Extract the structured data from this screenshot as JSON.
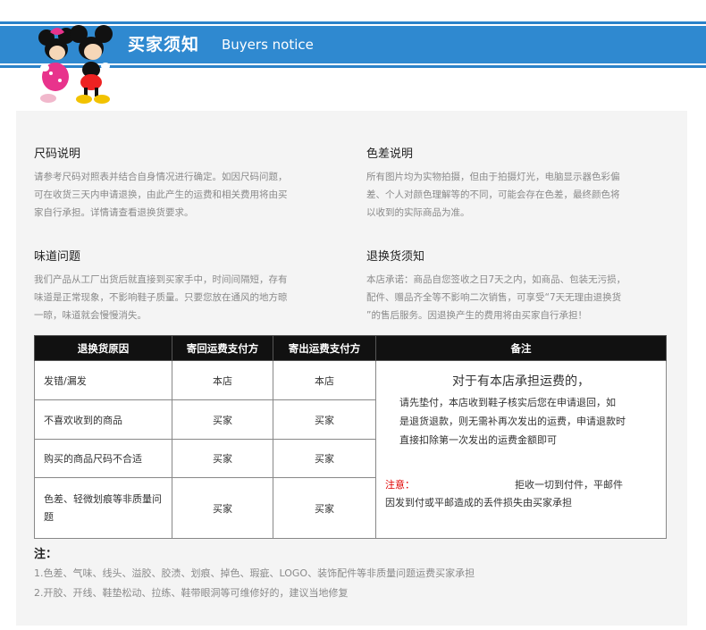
{
  "header": {
    "title": "买家须知",
    "subtitle": "Buyers notice"
  },
  "colors": {
    "band": "#2f89d0",
    "panel": "#f4f4f4",
    "table_header": "#111111",
    "attention": "#e00000"
  },
  "sections": {
    "size": {
      "title": "尺码说明",
      "lines": [
        "请参考尺码对照表并结合自身情况进行确定。如因尺码问题，",
        "可在收货三天内申请退换，由此产生的运费和相关费用将由买",
        "家自行承担。详情请查看退换货要求。"
      ]
    },
    "color": {
      "title": "色差说明",
      "lines": [
        "所有图片均为实物拍摄，但由于拍摄灯光，电脑显示器色彩偏",
        "差、个人对颜色理解等的不同，可能会存在色差，最终颜色将",
        "以收到的实际商品为准。"
      ]
    },
    "smell": {
      "title": "味道问题",
      "lines": [
        "我们产品从工厂出货后就直接到买家手中，时间间隔短，存有",
        "味道是正常现象，不影响鞋子质量。只要您放在通风的地方晾",
        "一晾，味道就会慢慢消失。"
      ]
    },
    "returns": {
      "title": "退换货须知",
      "lines": [
        "本店承诺：商品自您签收之日7天之内，如商品、包装无污损，",
        "配件、赠品齐全等不影响二次销售，可享受“7天无理由退换货",
        "”的售后服务。因退换产生的费用将由买家自行承担！"
      ]
    }
  },
  "table": {
    "headers": [
      "退换货原因",
      "寄回运费支付方",
      "寄出运费支付方",
      "备注"
    ],
    "rows": [
      {
        "reason": "发错/漏发",
        "return_payer": "本店",
        "send_payer": "本店"
      },
      {
        "reason": "不喜欢收到的商品",
        "return_payer": "买家",
        "send_payer": "买家"
      },
      {
        "reason": "购买的商品尺码不合适",
        "return_payer": "买家",
        "send_payer": "买家"
      },
      {
        "reason": "色差、轻微划痕等非质量问题",
        "return_payer": "买家",
        "send_payer": "买家"
      }
    ],
    "remark": {
      "heading": "对于有本店承担运费的，",
      "lines": [
        "请先垫付，本店收到鞋子核实后您在申请退回，如",
        "是退货退款，则无需补再次发出的运费，申请退款时",
        "直接扣除第一次发出的运费金额即可"
      ],
      "attention_label": "注意：",
      "attention_text_1": "拒收一切到付件，平邮件",
      "attention_text_2": "因发到付或平邮造成的丢件损失由买家承担"
    }
  },
  "footnotes": {
    "title": "注：",
    "items": [
      "1.色差、气味、线头、溢胶、胶渍、划痕、掉色、瑕疵、LOGO、装饰配件等非质量问题运费买家承担",
      "2.开胶、开线、鞋垫松动、拉练、鞋带眼洞等可维修好的，建议当地修复"
    ]
  }
}
